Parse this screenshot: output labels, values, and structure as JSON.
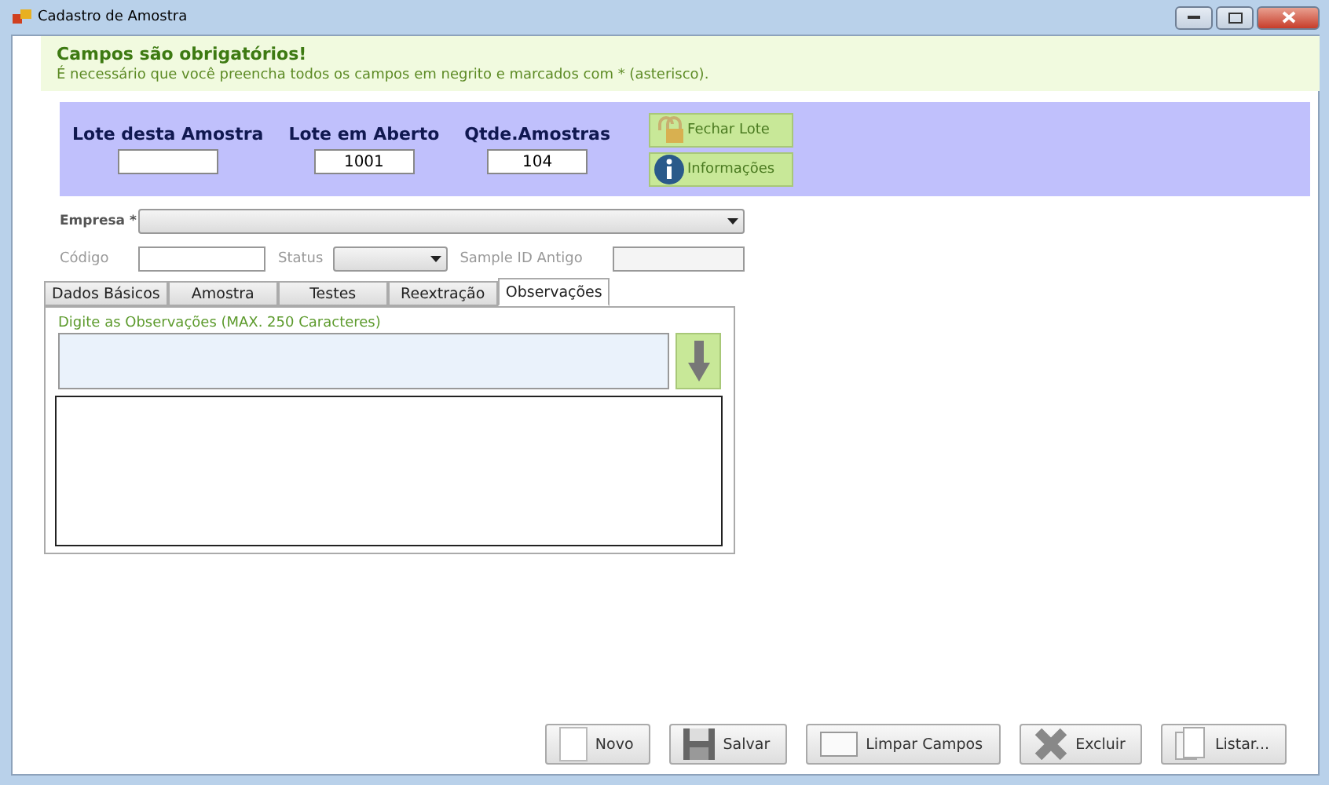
{
  "window": {
    "title": "Cadastro de Amostra"
  },
  "notice": {
    "title": "Campos são obrigatórios!",
    "message": "É necessário que você preencha todos os campos em negrito e marcados com * (asterisco)."
  },
  "lot_panel": {
    "fields": [
      {
        "label": "Lote desta Amostra"
      },
      {
        "label": "Lote em Aberto",
        "value": "1001"
      },
      {
        "label": "Qtde.Amostras",
        "value": "104"
      }
    ],
    "buttons": [
      {
        "label": "Fechar Lote",
        "kind": "lock"
      },
      {
        "label": "Informações",
        "kind": "info"
      }
    ]
  },
  "form": {
    "empresa_label": "Empresa *",
    "codigo_label": "Código",
    "status_label": "Status",
    "sample_id_label": "Sample ID Antigo"
  },
  "tabs": [
    {
      "label": "Dados Básicos",
      "selected": false
    },
    {
      "label": "Amostra",
      "selected": false
    },
    {
      "label": "Testes",
      "selected": false
    },
    {
      "label": "Reextração",
      "selected": false
    },
    {
      "label": "Observações",
      "selected": true
    }
  ],
  "observations": {
    "label": "Digite as Observações (MAX. 250 Caracteres)"
  },
  "buttons": [
    {
      "label": "Novo",
      "kind": "new"
    },
    {
      "label": "Salvar",
      "kind": "save"
    },
    {
      "label": "Limpar Campos",
      "kind": "clear"
    },
    {
      "label": "Excluir",
      "kind": "delete"
    },
    {
      "label": "Listar...",
      "kind": "list"
    }
  ]
}
